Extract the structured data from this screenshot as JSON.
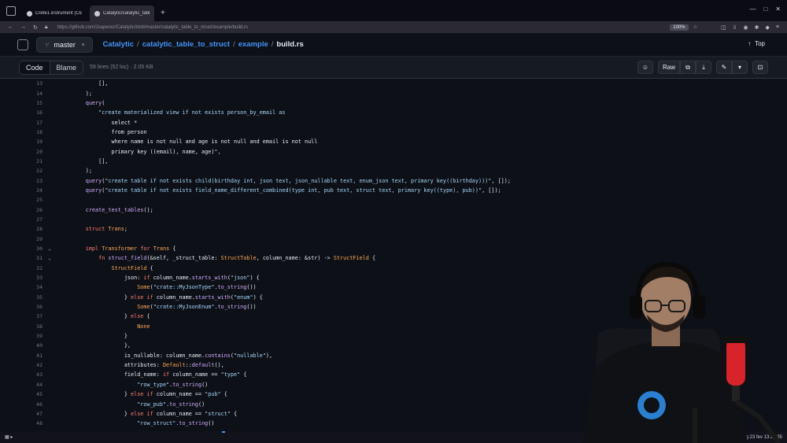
{
  "browser": {
    "tabs": [
      {
        "label": "Crete1.instrument (Claude) ×",
        "active": false
      },
      {
        "label": "Catalytic/catalytic_table ×",
        "active": true
      }
    ],
    "url": "https://github.com/Jsaperez/Catalytic/blob/master/catalytic_table_to_struct/example/build.rs",
    "zoom": "100%"
  },
  "header": {
    "branch": "master",
    "breadcrumb": [
      "Catalytic",
      "catalytic_table_to_struct",
      "example",
      "build.rs"
    ],
    "top_label": "Top"
  },
  "toolbar": {
    "code_label": "Code",
    "blame_label": "Blame",
    "file_info": "59 lines (52 loc) · 2.05 KB",
    "raw_label": "Raw"
  },
  "code_lines": [
    {
      "n": "13",
      "t": "            [],"
    },
    {
      "n": "14",
      "t": "        );"
    },
    {
      "n": "15",
      "t": "        query("
    },
    {
      "n": "16",
      "t": "            \"create materialized view if not exists person_by_email as"
    },
    {
      "n": "17",
      "t": "                select *"
    },
    {
      "n": "18",
      "t": "                from person"
    },
    {
      "n": "19",
      "t": "                where name is not null and age is not null and email is not null"
    },
    {
      "n": "20",
      "t": "                primary key ((email), name, age)\","
    },
    {
      "n": "21",
      "t": "            [],"
    },
    {
      "n": "22",
      "t": "        );"
    },
    {
      "n": "23",
      "t": "        query(\"create table if not exists child(birthday int, json text, json_nullable text, enum_json text, primary key((birthday)))\", []);"
    },
    {
      "n": "24",
      "t": "        query(\"create table if not exists field_name_different_combined(type int, pub text, struct text, primary key((type), pub))\", []);"
    },
    {
      "n": "25",
      "t": ""
    },
    {
      "n": "26",
      "t": "        create_test_tables();"
    },
    {
      "n": "27",
      "t": ""
    },
    {
      "n": "28",
      "t": "        struct Trans;"
    },
    {
      "n": "29",
      "t": ""
    },
    {
      "n": "30",
      "t": "        impl Transformer for Trans {",
      "fold": true
    },
    {
      "n": "31",
      "t": "            fn struct_field(&self, _struct_table: StructTable, column_name: &str) -> StructField {",
      "fold": true
    },
    {
      "n": "32",
      "t": "                StructField {"
    },
    {
      "n": "33",
      "t": "                    json: if column_name.starts_with(\"json\") {"
    },
    {
      "n": "34",
      "t": "                        Some(\"crate::MyJsonType\".to_string())"
    },
    {
      "n": "35",
      "t": "                    } else if column_name.starts_with(\"enum\") {"
    },
    {
      "n": "36",
      "t": "                        Some(\"crate::MyJsonEnum\".to_string())"
    },
    {
      "n": "37",
      "t": "                    } else {"
    },
    {
      "n": "38",
      "t": "                        None"
    },
    {
      "n": "39",
      "t": "                    }"
    },
    {
      "n": "40",
      "t": "                    },"
    },
    {
      "n": "41",
      "t": "                    is_nullable: column_name.contains(\"nullable\"),"
    },
    {
      "n": "42",
      "t": "                    attributes: Default::default(),"
    },
    {
      "n": "43",
      "t": "                    field_name: if column_name == \"type\" {"
    },
    {
      "n": "44",
      "t": "                        \"row_type\".to_string()"
    },
    {
      "n": "45",
      "t": "                    } else if column_name == \"pub\" {"
    },
    {
      "n": "46",
      "t": "                        \"row_pub\".to_string()"
    },
    {
      "n": "47",
      "t": "                    } else if column_name == \"struct\" {"
    },
    {
      "n": "48",
      "t": "                        \"row_struct\".to_string()"
    },
    {
      "n": "49",
      "t": "                    } else {"
    }
  ],
  "taskbar": {
    "clock": "seg 23 fev 13:27:35"
  }
}
